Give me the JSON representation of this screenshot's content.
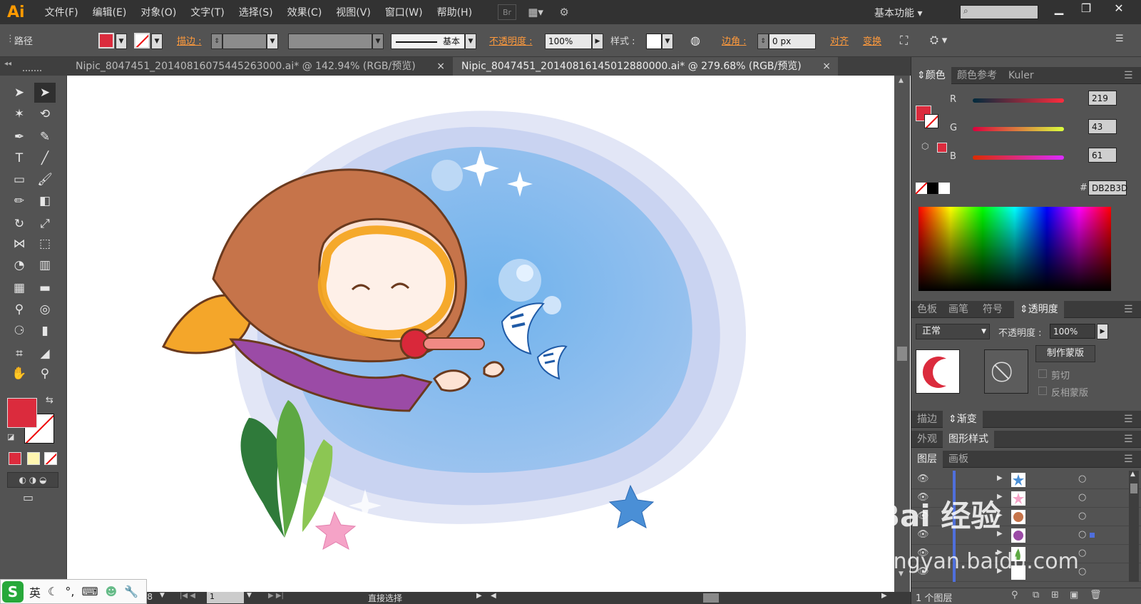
{
  "app": {
    "logo": "Ai"
  },
  "menu": [
    "文件(F)",
    "编辑(E)",
    "对象(O)",
    "文字(T)",
    "选择(S)",
    "效果(C)",
    "视图(V)",
    "窗口(W)",
    "帮助(H)"
  ],
  "menu_extra": {
    "bridge": "Br",
    "workspace": "基本功能"
  },
  "control": {
    "selection_type": "路径",
    "stroke_label": "描边 :",
    "brush_label": "基本",
    "opacity_label": "不透明度 :",
    "opacity_value": "100%",
    "style_label": "样式 :",
    "corner_label": "边角 :",
    "corner_value": "0 px",
    "align_label": "对齐",
    "transform_label": "变换"
  },
  "tabs": [
    {
      "label": "Nipic_8047451_20140816075445263000.ai* @ 142.94% (RGB/预览)",
      "close": "×"
    },
    {
      "label": "Nipic_8047451_20140816145012880000.ai* @ 279.68% (RGB/预览)",
      "close": "×"
    }
  ],
  "colors": {
    "fill": "#DB2B3D",
    "accent": "#ff9a3c"
  },
  "color_panel": {
    "tabs": [
      "颜色",
      "颜色参考",
      "Kuler"
    ],
    "r_label": "R",
    "r_value": "219",
    "g_label": "G",
    "g_value": "43",
    "b_label": "B",
    "b_value": "61",
    "hex_label": "#",
    "hex_value": "DB2B3D"
  },
  "swatch_panel": {
    "tabs": [
      "色板",
      "画笔",
      "符号",
      "透明度"
    ]
  },
  "transparency": {
    "mode": "正常",
    "opacity_label": "不透明度 :",
    "opacity_value": "100%",
    "make_mask": "制作蒙版",
    "clip": "剪切",
    "invert": "反相蒙版"
  },
  "stroke_panel": {
    "tabs": [
      "描边",
      "渐变"
    ]
  },
  "appearance_panel": {
    "tabs": [
      "外观",
      "图形样式"
    ]
  },
  "layers_panel": {
    "tabs": [
      "图层",
      "画板"
    ],
    "count": "1 个图层"
  },
  "status": {
    "zoom": "279.68",
    "page": "1",
    "tool": "直接选择"
  },
  "ime": {
    "logo": "S",
    "lang": "英"
  },
  "watermark": {
    "brand": "Bai  经验",
    "url": "jingyan.baidu.com"
  }
}
